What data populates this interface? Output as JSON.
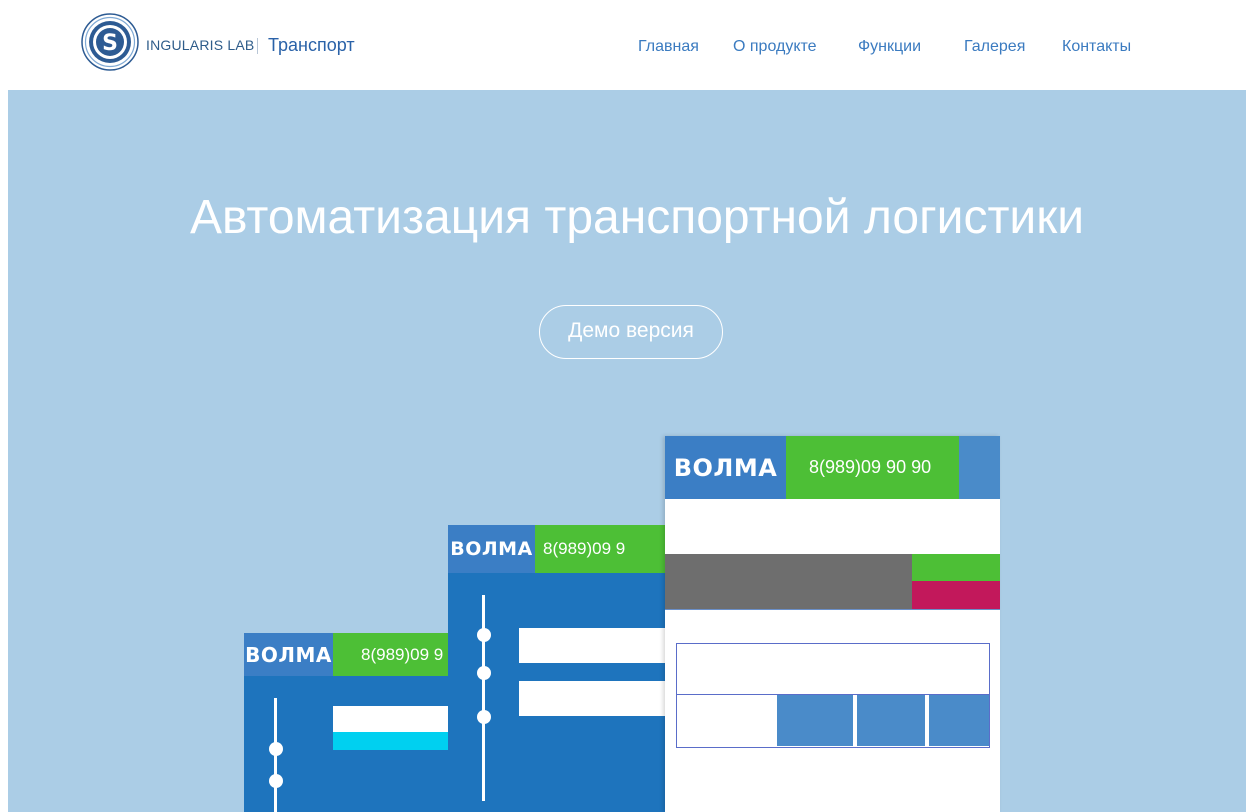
{
  "header": {
    "logo_text": "INGULARIS LAB",
    "product": "Транспорт",
    "nav": [
      "Главная",
      "О продукте",
      "Функции",
      "Галерея",
      "Контакты"
    ]
  },
  "hero": {
    "title": "Автоматизация транспортной логистики",
    "button": "Демо версия"
  },
  "mockups": {
    "brand": "ВОЛМА",
    "phone_small": "8(989)09 9",
    "phone_mid": "8(989)09 9",
    "phone_large": "8(989)09 90 90"
  },
  "colors": {
    "hero_bg": "#abcde6",
    "mock_blue": "#1e74bd",
    "mock_header_blue": "#3b7ec5",
    "phone_green": "#4dbf36",
    "panel_grey": "#6e6e6e",
    "accent_magenta": "#c2185b",
    "cyan": "#00d0f0"
  }
}
